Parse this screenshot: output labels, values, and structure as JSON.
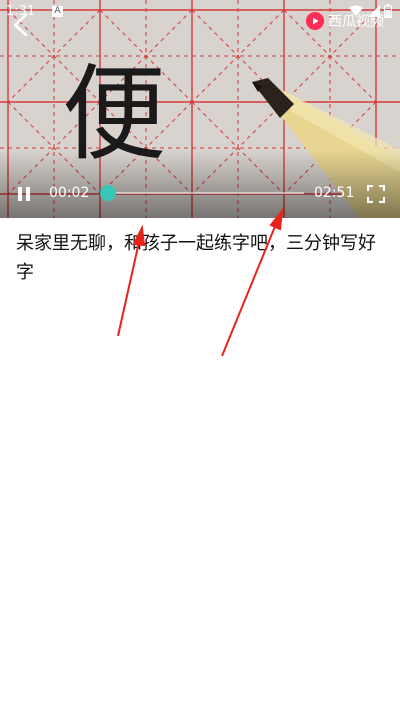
{
  "status_bar": {
    "time": "1:31",
    "notification_badge": "A",
    "icons": [
      "wifi-icon",
      "signal-icon",
      "battery-icon"
    ]
  },
  "player": {
    "brand_name": "西瓜视频",
    "current_time": "00:02",
    "total_time": "02:51",
    "progress_fraction": 0.012,
    "accent_color": "#36c7b7",
    "video_glyph": "便"
  },
  "title": "呆家里无聊，和孩子一起练字吧，三分钟写好字",
  "annotation": {
    "arrow_color": "#e8231a",
    "arrow_count": 2
  }
}
